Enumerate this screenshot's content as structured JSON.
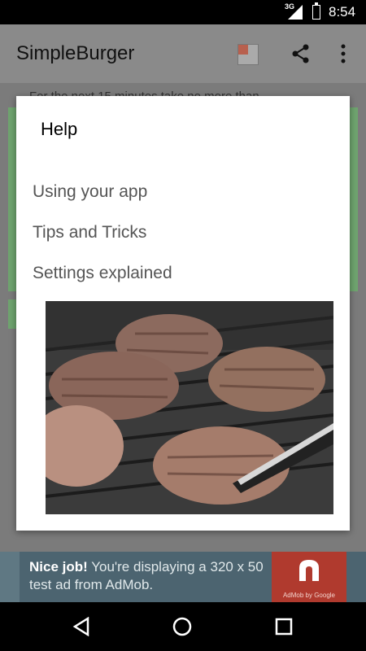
{
  "status": {
    "time": "8:54",
    "network": "3G"
  },
  "app": {
    "title": "SimpleBurger"
  },
  "background": {
    "partial_text": "For the next 15 minutes take no more than..."
  },
  "dialog": {
    "title": "Help",
    "items": [
      {
        "label": "Using your app"
      },
      {
        "label": "Tips and Tricks"
      },
      {
        "label": "Settings explained"
      }
    ]
  },
  "ad": {
    "headline": "Nice job!",
    "body": " You're displaying a 320 x 50 test ad from AdMob.",
    "brand": "AdMob by Google"
  },
  "colors": {
    "ad_bg": "#4c6470",
    "ad_logo": "#b03a2e",
    "card_green": "#6fa46f"
  }
}
